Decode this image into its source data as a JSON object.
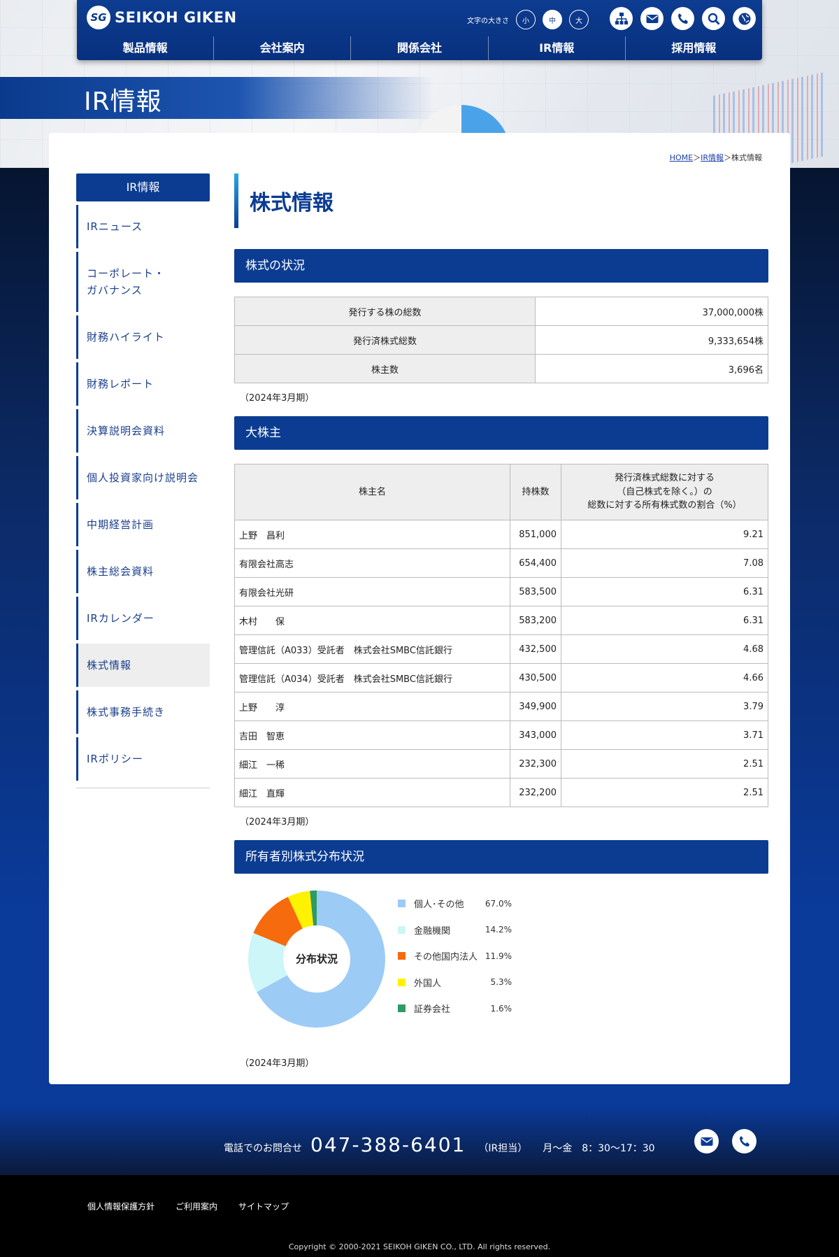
{
  "brand": {
    "logo_mark": "SG",
    "name": "SEIKOH GIKEN"
  },
  "font_size_control": {
    "label": "文字の大きさ",
    "options": [
      "小",
      "中",
      "大"
    ],
    "selected": "中"
  },
  "header_tools": [
    "sitemap-icon",
    "mail-icon",
    "phone-icon",
    "search-icon",
    "globe-icon"
  ],
  "global_nav": [
    "製品情報",
    "会社案内",
    "関係会社",
    "IR情報",
    "採用情報"
  ],
  "hero": {
    "title": "IR情報"
  },
  "breadcrumb": {
    "home": "HOME",
    "sep1": "＞",
    "parent": "IR情報",
    "sep2": "＞",
    "current": "株式情報"
  },
  "sidebar": {
    "title": "IR情報",
    "items": [
      "IRニュース",
      "コーポレート・\nガバナンス",
      "財務ハイライト",
      "財務レポート",
      "決算説明会資料",
      "個人投資家向け説明会",
      "中期経営計画",
      "株主総会資料",
      "IRカレンダー",
      "株式情報",
      "株式事務手続き",
      "IRポリシー"
    ],
    "active": "株式情報"
  },
  "page_title": "株式情報",
  "stock_status": {
    "heading": "株式の状況",
    "rows": [
      {
        "label": "発行する株の総数",
        "value": "37,000,000株"
      },
      {
        "label": "発行済株式総数",
        "value": "9,333,654株"
      },
      {
        "label": "株主数",
        "value": "3,696名"
      }
    ],
    "note": "（2024年3月期）"
  },
  "major_shareholders": {
    "heading": "大株主",
    "columns": [
      "株主名",
      "持株数",
      "発行済株式総数に対する\n（自己株式を除く。）の\n総数に対する所有株式数の割合（%）"
    ],
    "rows": [
      [
        "上野　昌利",
        "851,000",
        "9.21"
      ],
      [
        "有限会社高志",
        "654,400",
        "7.08"
      ],
      [
        "有限会社光研",
        "583,500",
        "6.31"
      ],
      [
        "木村　　保",
        "583,200",
        "6.31"
      ],
      [
        "管理信託（A033）受託者　株式会社SMBC信託銀行",
        "432,500",
        "4.68"
      ],
      [
        "管理信託（A034）受託者　株式会社SMBC信託銀行",
        "430,500",
        "4.66"
      ],
      [
        "上野　　淳",
        "349,900",
        "3.79"
      ],
      [
        "吉田　智恵",
        "343,000",
        "3.71"
      ],
      [
        "細江　一稀",
        "232,300",
        "2.51"
      ],
      [
        "細江　直輝",
        "232,200",
        "2.51"
      ]
    ],
    "note": "（2024年3月期）"
  },
  "distribution": {
    "heading": "所有者別株式分布状況",
    "center_label": "分布状況",
    "note": "（2024年3月期）"
  },
  "chart_data": {
    "type": "pie",
    "categories": [
      "個人･その他",
      "金融機関",
      "その他国内法人",
      "外国人",
      "証券会社"
    ],
    "values": [
      67.0,
      14.2,
      11.9,
      5.3,
      1.6
    ],
    "labels": [
      "67.0%",
      "14.2%",
      "11.9%",
      "5.3%",
      "1.6%"
    ],
    "colors": [
      "#9ccbf5",
      "#ccf6f8",
      "#f66b0e",
      "#fff200",
      "#2f9a63"
    ],
    "donut": true,
    "legend": "right"
  },
  "contact": {
    "label": "電話でのお問合せ",
    "tel": "047-388-6401",
    "dept": "（IR担当）",
    "hours": "月〜金　8：30〜17：30",
    "icons": [
      "mail-icon",
      "phone-icon"
    ]
  },
  "footer": {
    "links": [
      "個人情報保護方針",
      "ご利用案内",
      "サイトマップ"
    ],
    "copyright": "Copyright © 2000-2021 SEIKOH GIKEN CO., LTD. All rights reserved."
  }
}
